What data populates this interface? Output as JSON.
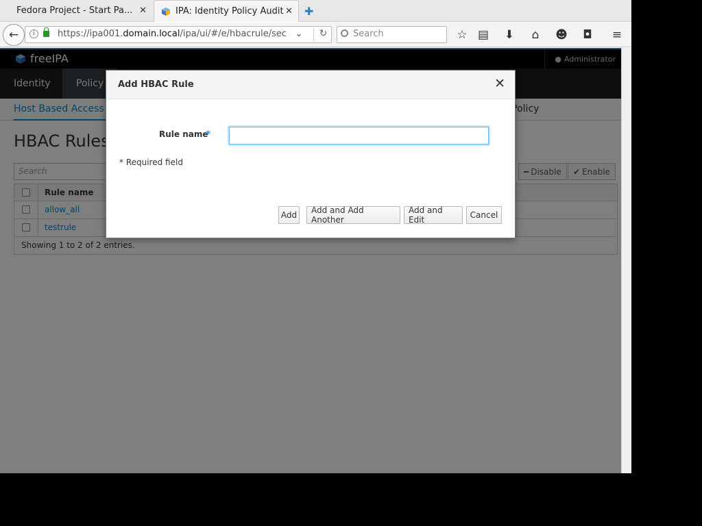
{
  "browser": {
    "tabs": [
      {
        "title": "Fedora Project - Start Pa..."
      },
      {
        "title": "IPA: Identity Policy Audit"
      }
    ],
    "url": {
      "prefix": "https://ipa001.",
      "host": "domain.local",
      "path": "/ipa/ui/#/e/hbacrule/sec"
    },
    "search_placeholder": "Search"
  },
  "app": {
    "logo": "freeIPA",
    "user": "Administrator",
    "menu": [
      "Identity",
      "Policy"
    ],
    "subnav": {
      "active": "Host Based Access C",
      "other": "ket Policy"
    },
    "page_title": "HBAC Rules",
    "filter_placeholder": "Search",
    "actions": {
      "disable": "Disable",
      "enable": "Enable"
    },
    "table": {
      "column": "Rule name",
      "rows": [
        "allow_all",
        "testrule"
      ],
      "footer": "Showing 1 to 2 of 2 entries."
    }
  },
  "dialog": {
    "title": "Add HBAC Rule",
    "field_label": "Rule name",
    "field_value": "",
    "required_mark": "*",
    "required_note": "* Required field",
    "buttons": {
      "add": "Add",
      "add_another": "Add and Add Another",
      "add_edit": "Add and Edit",
      "cancel": "Cancel"
    }
  },
  "colors": {
    "accent": "#0088ce",
    "header_bg": "#030303",
    "menu_bg": "#1d1d1d"
  }
}
